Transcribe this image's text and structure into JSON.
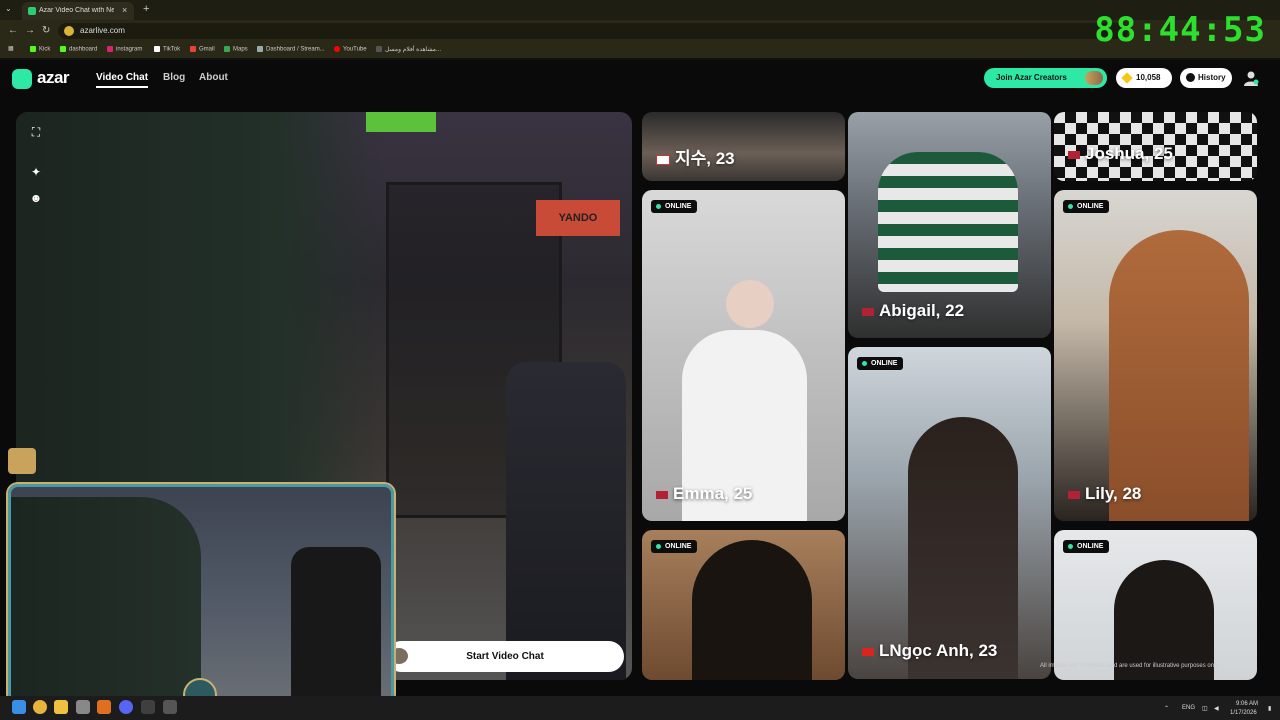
{
  "browser": {
    "tab_title": "Azar Video Chat with New",
    "url": "azarlive.com",
    "bookmarks": [
      "Kick",
      "dashboard",
      "instagram",
      "TikTok",
      "Gmail",
      "Maps",
      "Dashboard / Stream...",
      "YouTube",
      "مشاهدة أفلام ومسل..."
    ],
    "icons": {
      "back": "←",
      "forward": "→",
      "reload": "↻",
      "new_tab": "+",
      "close": "×",
      "tab_menu": "⌄"
    }
  },
  "stream_overlay": {
    "timer": "88:44:53"
  },
  "site": {
    "logo": "azar",
    "nav": [
      "Video Chat",
      "Blog",
      "About"
    ],
    "creators_button": "Join Azar Creators",
    "coins": "10,058",
    "history_button": "History"
  },
  "video_panel": {
    "sign_text": "YANDO",
    "start_button": "Start Video Chat",
    "tool_icons": [
      "fullscreen-icon",
      "magic-wand-icon",
      "face-filter-icon"
    ]
  },
  "gallery": {
    "online_label": "ONLINE",
    "cards": [
      {
        "name": "지수, 23",
        "flag": "kr",
        "online": false
      },
      {
        "name": "Abigail, 22",
        "flag": "us",
        "online": false
      },
      {
        "name": "Joshua, 25",
        "flag": "us",
        "online": false
      },
      {
        "name": "Emma, 25",
        "flag": "us",
        "online": true
      },
      {
        "name": "Lily, 28",
        "flag": "us",
        "online": true
      },
      {
        "name": "LNgọc Anh, 23",
        "flag": "vn",
        "online": true
      },
      {
        "name": "",
        "flag": "",
        "online": true
      },
      {
        "name": "",
        "flag": "",
        "online": true
      }
    ],
    "disclaimer": "All images are of models and are used for illustrative purposes only."
  },
  "taskbar": {
    "lang": "ENG",
    "time": "9:06 AM",
    "date": "1/17/2026"
  },
  "colors": {
    "accent": "#2ee8a6",
    "timer": "#2ee02e",
    "tab_bar": "#1f1e12"
  }
}
